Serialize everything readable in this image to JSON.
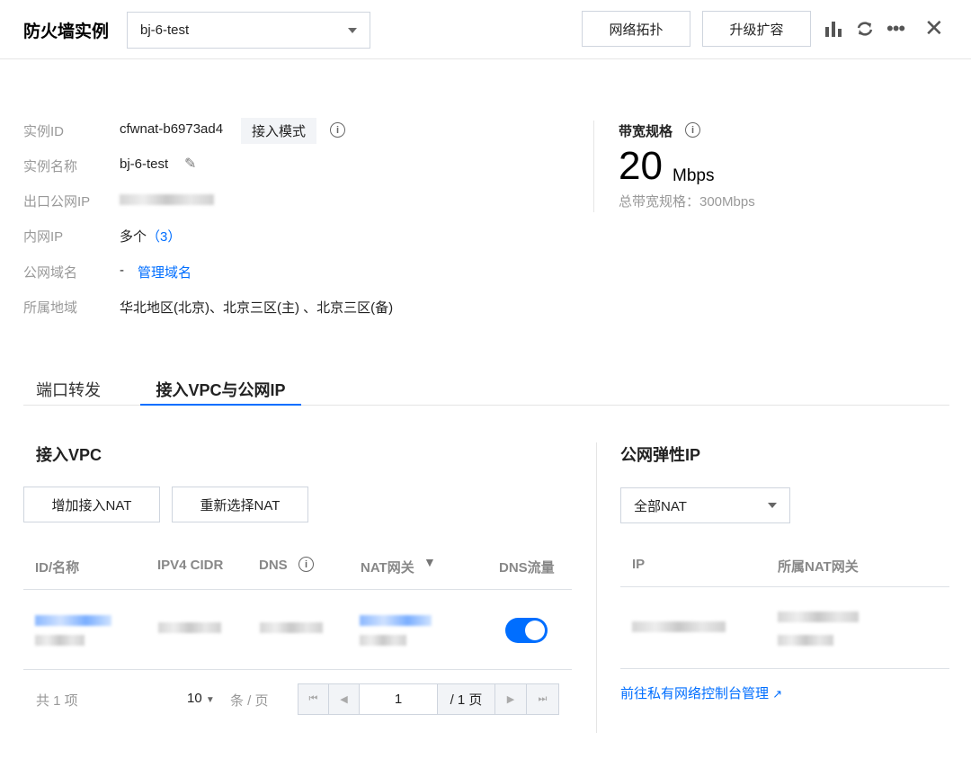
{
  "header": {
    "title": "防火墙实例",
    "instance_select": "bj-6-test",
    "topology_button": "网络拓扑",
    "upgrade_button": "升级扩容"
  },
  "info": {
    "instance_id_label": "实例ID",
    "instance_id": "cfwnat-b6973ad4",
    "mode_badge": "接入模式",
    "name_label": "实例名称",
    "name": "bj-6-test",
    "egress_ip_label": "出口公网IP",
    "internal_ip_label": "内网IP",
    "internal_ip": "多个",
    "internal_ip_count": "（3）",
    "domain_label": "公网域名",
    "domain": "-",
    "domain_link": "管理域名",
    "region_label": "所属地域",
    "region": "华北地区(北京)、北京三区(主) 、北京三区(备)"
  },
  "bandwidth": {
    "label": "带宽规格",
    "value": "20",
    "unit": "Mbps",
    "total": "总带宽规格：300Mbps"
  },
  "tabs": [
    {
      "label": "端口转发"
    },
    {
      "label": "接入VPC与公网IP"
    }
  ],
  "vpc": {
    "title": "接入VPC",
    "add_button": "增加接入NAT",
    "reselect_button": "重新选择NAT",
    "columns": [
      "ID/名称",
      "IPV4 CIDR",
      "DNS",
      "NAT网关",
      "DNS流量"
    ],
    "dns_toggle_on": true,
    "pagination": {
      "total": "共 1 项",
      "page_size": "10",
      "per_page": "条 / 页",
      "current": "1",
      "pages": "/ 1 页"
    }
  },
  "eip": {
    "title": "公网弹性IP",
    "filter": "全部NAT",
    "columns": [
      "IP",
      "所属NAT网关"
    ],
    "link": "前往私有网络控制台管理"
  }
}
